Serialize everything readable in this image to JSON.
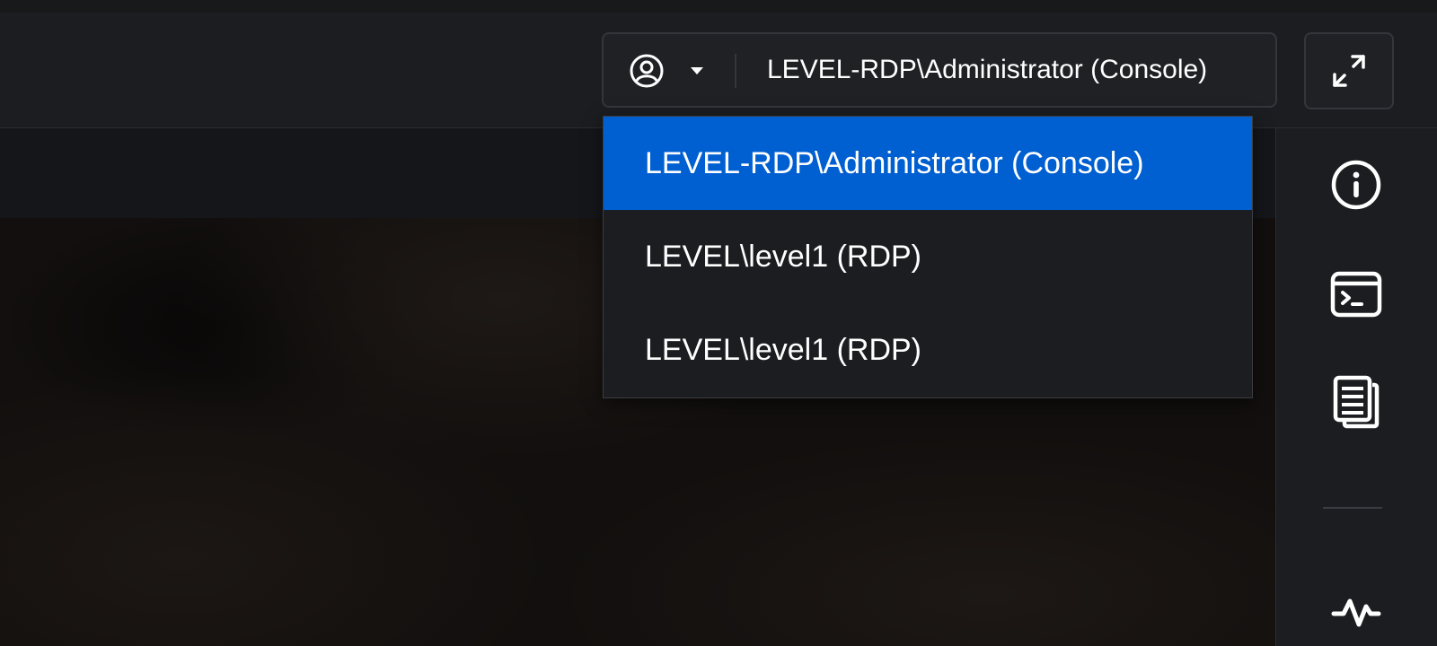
{
  "session": {
    "current_user": "LEVEL-RDP\\Administrator (Console)",
    "options": [
      {
        "label": "LEVEL-RDP\\Administrator (Console)",
        "selected": true
      },
      {
        "label": "LEVEL\\level1 (RDP)",
        "selected": false
      },
      {
        "label": "LEVEL\\level1 (RDP)",
        "selected": false
      }
    ]
  },
  "icons": {
    "user": "user-circle-icon",
    "caret": "caret-down-icon",
    "fullscreen": "expand-icon",
    "info": "info-icon",
    "terminal": "terminal-icon",
    "copy": "copy-documents-icon",
    "activity": "activity-pulse-icon"
  },
  "colors": {
    "selected_item": "#005fd1",
    "panel": "#1b1d20",
    "text": "#ffffff"
  }
}
